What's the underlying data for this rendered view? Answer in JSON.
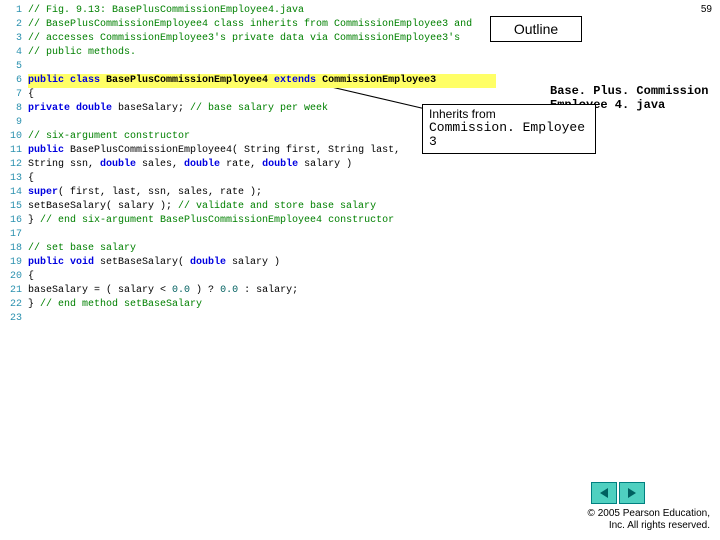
{
  "page_number": "59",
  "outline_label": "Outline",
  "file_title_l1": "Base. Plus. Commission",
  "file_title_l2": "Employee 4. java",
  "callout": {
    "line1": "Inherits from",
    "line2": "Commission. Employee 3"
  },
  "code": [
    {
      "n": "1",
      "segs": [
        {
          "c": "c-g",
          "t": "// Fig. 9.13: BasePlusCommissionEmployee4.java"
        }
      ]
    },
    {
      "n": "2",
      "segs": [
        {
          "c": "c-g",
          "t": "// BasePlusCommissionEmployee4 class inherits from CommissionEmployee3 and"
        }
      ]
    },
    {
      "n": "3",
      "segs": [
        {
          "c": "c-g",
          "t": "// accesses CommissionEmployee3's private data via CommissionEmployee3's"
        }
      ]
    },
    {
      "n": "4",
      "segs": [
        {
          "c": "c-g",
          "t": "// public methods."
        }
      ]
    },
    {
      "n": "5",
      "segs": []
    },
    {
      "n": "6",
      "hl": true,
      "segs": [
        {
          "c": "c-b",
          "t": "public class "
        },
        {
          "c": "c-n",
          "t": "BasePlusCommissionEmployee4 "
        },
        {
          "c": "c-b",
          "t": "extends "
        },
        {
          "c": "c-n",
          "t": "CommissionEmployee3"
        }
      ]
    },
    {
      "n": "7",
      "segs": [
        {
          "c": "c-nb",
          "t": "{"
        }
      ]
    },
    {
      "n": "8",
      "segs": [
        {
          "c": "c-nb",
          "t": "   "
        },
        {
          "c": "c-b",
          "t": "private double "
        },
        {
          "c": "c-nb",
          "t": "baseSalary; "
        },
        {
          "c": "c-g",
          "t": "// base salary per week"
        }
      ]
    },
    {
      "n": "9",
      "segs": []
    },
    {
      "n": "10",
      "segs": [
        {
          "c": "c-nb",
          "t": "   "
        },
        {
          "c": "c-g",
          "t": "// six-argument constructor"
        }
      ]
    },
    {
      "n": "11",
      "segs": [
        {
          "c": "c-nb",
          "t": "   "
        },
        {
          "c": "c-b",
          "t": "public "
        },
        {
          "c": "c-nb",
          "t": "BasePlusCommissionEmployee4( String first, String last,"
        }
      ]
    },
    {
      "n": "12",
      "segs": [
        {
          "c": "c-nb",
          "t": "      String ssn, "
        },
        {
          "c": "c-b",
          "t": "double "
        },
        {
          "c": "c-nb",
          "t": "sales, "
        },
        {
          "c": "c-b",
          "t": "double "
        },
        {
          "c": "c-nb",
          "t": "rate, "
        },
        {
          "c": "c-b",
          "t": "double "
        },
        {
          "c": "c-nb",
          "t": "salary )"
        }
      ]
    },
    {
      "n": "13",
      "segs": [
        {
          "c": "c-nb",
          "t": "   {"
        }
      ]
    },
    {
      "n": "14",
      "segs": [
        {
          "c": "c-nb",
          "t": "      "
        },
        {
          "c": "c-b",
          "t": "super"
        },
        {
          "c": "c-nb",
          "t": "( first, last, ssn, sales, rate );"
        }
      ]
    },
    {
      "n": "15",
      "segs": [
        {
          "c": "c-nb",
          "t": "      setBaseSalary( salary ); "
        },
        {
          "c": "c-g",
          "t": "// validate and store base salary"
        }
      ]
    },
    {
      "n": "16",
      "segs": [
        {
          "c": "c-nb",
          "t": "   } "
        },
        {
          "c": "c-g",
          "t": "// end six-argument BasePlusCommissionEmployee4 constructor"
        }
      ]
    },
    {
      "n": "17",
      "segs": []
    },
    {
      "n": "18",
      "segs": [
        {
          "c": "c-nb",
          "t": "   "
        },
        {
          "c": "c-g",
          "t": "// set base salary"
        }
      ]
    },
    {
      "n": "19",
      "segs": [
        {
          "c": "c-nb",
          "t": "   "
        },
        {
          "c": "c-b",
          "t": "public void "
        },
        {
          "c": "c-nb",
          "t": "setBaseSalary( "
        },
        {
          "c": "c-b",
          "t": "double "
        },
        {
          "c": "c-nb",
          "t": "salary )"
        }
      ]
    },
    {
      "n": "20",
      "segs": [
        {
          "c": "c-nb",
          "t": "   {"
        }
      ]
    },
    {
      "n": "21",
      "segs": [
        {
          "c": "c-nb",
          "t": "      baseSalary = ( salary < "
        },
        {
          "c": "c-t",
          "t": "0.0"
        },
        {
          "c": "c-nb",
          "t": " ) ? "
        },
        {
          "c": "c-t",
          "t": "0.0"
        },
        {
          "c": "c-nb",
          "t": " : salary;"
        }
      ]
    },
    {
      "n": "22",
      "segs": [
        {
          "c": "c-nb",
          "t": "   } "
        },
        {
          "c": "c-g",
          "t": "// end method setBaseSalary"
        }
      ]
    },
    {
      "n": "23",
      "segs": []
    }
  ],
  "footer": {
    "l1": "© 2005 Pearson Education,",
    "l2": "Inc. All rights reserved."
  },
  "icons": {
    "prev": "prev-icon",
    "next": "next-icon"
  }
}
